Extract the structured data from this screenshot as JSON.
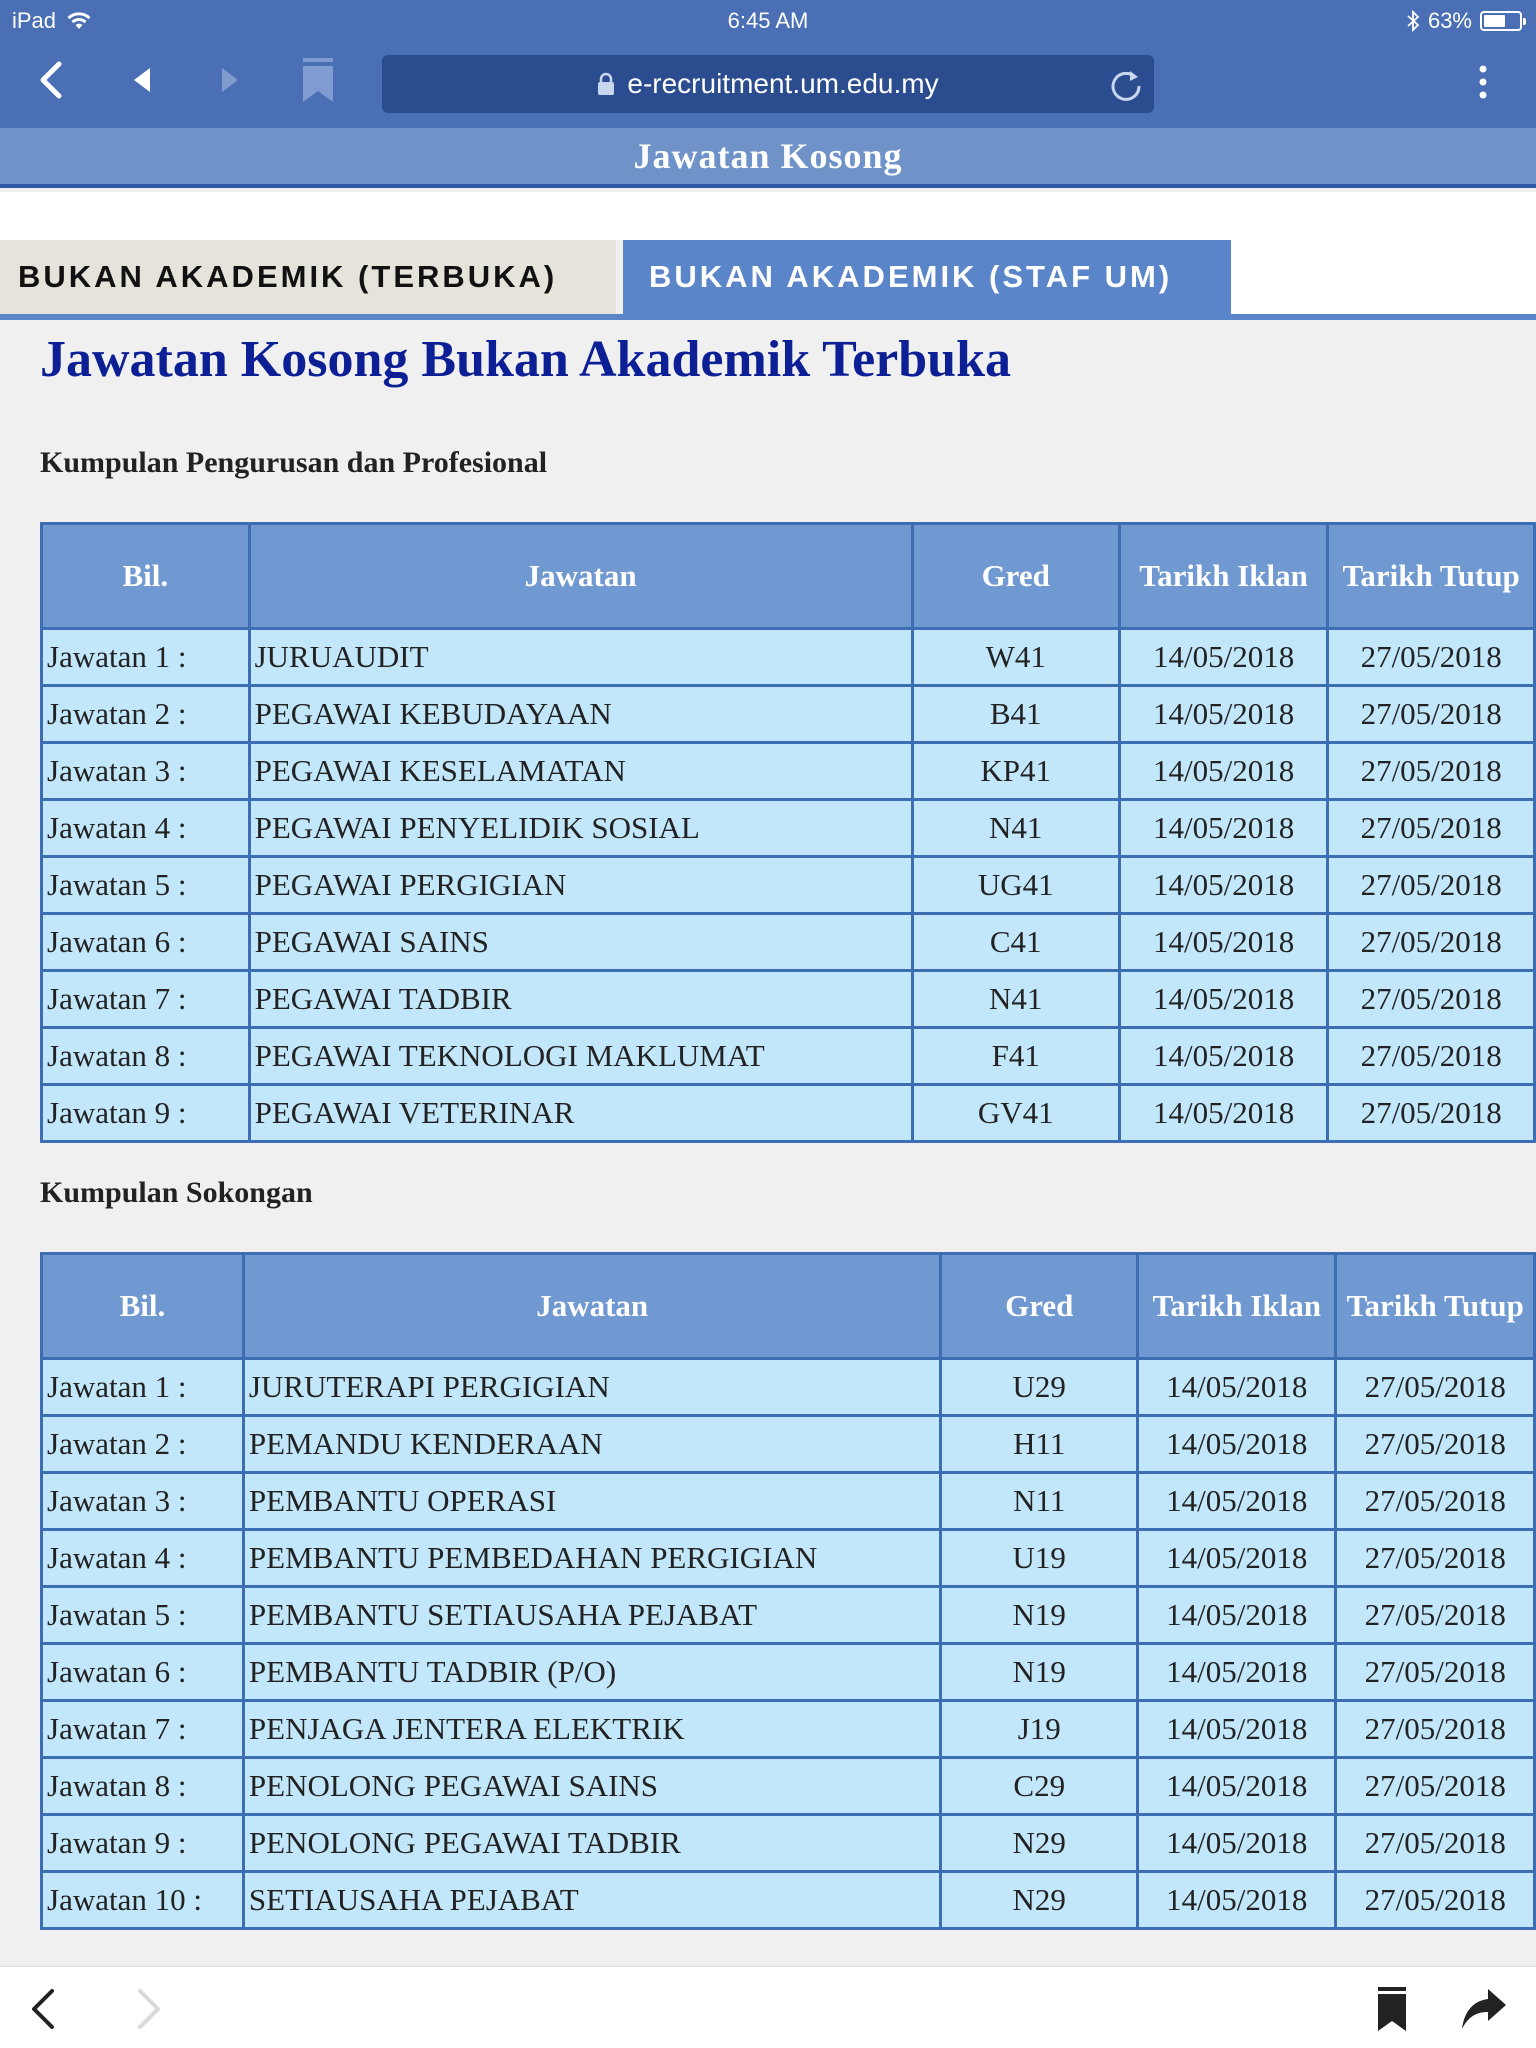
{
  "status_bar": {
    "device": "iPad",
    "time": "6:45 AM",
    "battery": "63%",
    "battery_level": 0.63
  },
  "browser": {
    "url": "e-recruitment.um.edu.my"
  },
  "page_header": "Jawatan Kosong",
  "tabs": [
    {
      "label": "BUKAN AKADEMIK (TERBUKA)",
      "active": true
    },
    {
      "label": "BUKAN AKADEMIK (STAF UM)",
      "active": false
    }
  ],
  "page_title": "Jawatan Kosong Bukan Akademik Terbuka",
  "sections": [
    {
      "label": "Kumpulan Pengurusan dan Profesional",
      "headers": [
        "Bil.",
        "Jawatan",
        "Gred",
        "Tarikh Iklan",
        "Tarikh Tutup"
      ],
      "rows": [
        [
          "Jawatan 1 :",
          "JURUAUDIT",
          "W41",
          "14/05/2018",
          "27/05/2018"
        ],
        [
          "Jawatan 2 :",
          "PEGAWAI KEBUDAYAAN",
          "B41",
          "14/05/2018",
          "27/05/2018"
        ],
        [
          "Jawatan 3 :",
          "PEGAWAI KESELAMATAN",
          "KP41",
          "14/05/2018",
          "27/05/2018"
        ],
        [
          "Jawatan 4 :",
          "PEGAWAI PENYELIDIK SOSIAL",
          "N41",
          "14/05/2018",
          "27/05/2018"
        ],
        [
          "Jawatan 5 :",
          "PEGAWAI PERGIGIAN",
          "UG41",
          "14/05/2018",
          "27/05/2018"
        ],
        [
          "Jawatan 6 :",
          "PEGAWAI SAINS",
          "C41",
          "14/05/2018",
          "27/05/2018"
        ],
        [
          "Jawatan 7 :",
          "PEGAWAI TADBIR",
          "N41",
          "14/05/2018",
          "27/05/2018"
        ],
        [
          "Jawatan 8 :",
          "PEGAWAI TEKNOLOGI MAKLUMAT",
          "F41",
          "14/05/2018",
          "27/05/2018"
        ],
        [
          "Jawatan 9 :",
          "PEGAWAI VETERINAR",
          "GV41",
          "14/05/2018",
          "27/05/2018"
        ]
      ]
    },
    {
      "label": "Kumpulan Sokongan",
      "headers": [
        "Bil.",
        "Jawatan",
        "Gred",
        "Tarikh Iklan",
        "Tarikh Tutup"
      ],
      "rows": [
        [
          "Jawatan 1 :",
          "JURUTERAPI PERGIGIAN",
          "U29",
          "14/05/2018",
          "27/05/2018"
        ],
        [
          "Jawatan 2 :",
          "PEMANDU KENDERAAN",
          "H11",
          "14/05/2018",
          "27/05/2018"
        ],
        [
          "Jawatan 3 :",
          "PEMBANTU OPERASI",
          "N11",
          "14/05/2018",
          "27/05/2018"
        ],
        [
          "Jawatan 4 :",
          "PEMBANTU PEMBEDAHAN PERGIGIAN",
          "U19",
          "14/05/2018",
          "27/05/2018"
        ],
        [
          "Jawatan 5 :",
          "PEMBANTU SETIAUSAHA PEJABAT",
          "N19",
          "14/05/2018",
          "27/05/2018"
        ],
        [
          "Jawatan 6 :",
          "PEMBANTU TADBIR (P/O)",
          "N19",
          "14/05/2018",
          "27/05/2018"
        ],
        [
          "Jawatan 7 :",
          "PENJAGA JENTERA ELEKTRIK",
          "J19",
          "14/05/2018",
          "27/05/2018"
        ],
        [
          "Jawatan 8 :",
          "PENOLONG PEGAWAI SAINS",
          "C29",
          "14/05/2018",
          "27/05/2018"
        ],
        [
          "Jawatan 9 :",
          "PENOLONG PEGAWAI TADBIR",
          "N29",
          "14/05/2018",
          "27/05/2018"
        ],
        [
          "Jawatan 10 :",
          "SETIAUSAHA PEJABAT",
          "N29",
          "14/05/2018",
          "27/05/2018"
        ]
      ]
    }
  ]
}
